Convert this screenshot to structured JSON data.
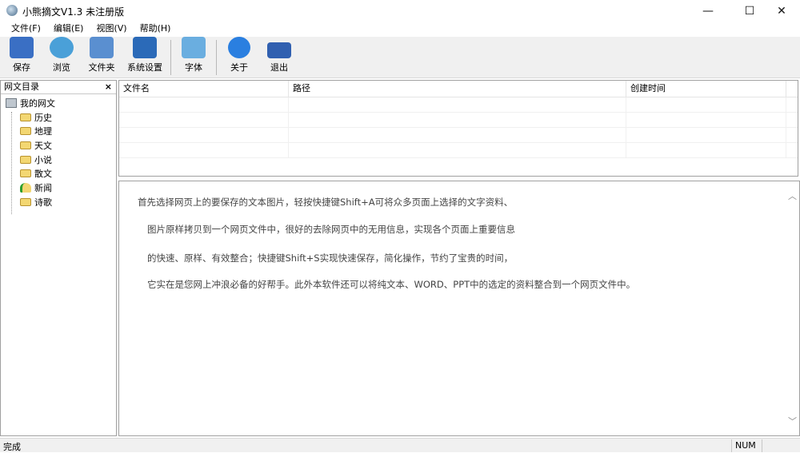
{
  "window": {
    "title": "小熊摘文V1.3 未注册版",
    "minimize": "—",
    "maximize": "☐",
    "close": "✕"
  },
  "menu": [
    "文件(F)",
    "编辑(E)",
    "视图(V)",
    "帮助(H)"
  ],
  "toolbar": [
    {
      "label": "保存",
      "icon": "save-icon",
      "color": "#3a6fc4"
    },
    {
      "label": "浏览",
      "icon": "browse-icon",
      "color": "#4aa0d8"
    },
    {
      "label": "文件夹",
      "icon": "folder-icon",
      "color": "#5a8fd0"
    },
    {
      "label": "系统设置",
      "icon": "settings-icon",
      "color": "#2b6ab8"
    },
    {
      "label": "字体",
      "icon": "font-icon",
      "color": "#6aaee0"
    },
    {
      "label": "关于",
      "icon": "info-icon",
      "color": "#2a7fe0"
    },
    {
      "label": "退出",
      "icon": "exit-icon",
      "color": "#3060b0"
    }
  ],
  "sidebar": {
    "title": "网文目录",
    "close": "×",
    "root": "我的网文",
    "items": [
      "历史",
      "地理",
      "天文",
      "小说",
      "散文",
      "新闻",
      "诗歌"
    ]
  },
  "grid": {
    "columns": [
      "文件名",
      "路径",
      "创建时间"
    ]
  },
  "content": {
    "paragraphs": [
      "首先选择网页上的要保存的文本图片，轻按快捷键Shift+A可将众多页面上选择的文字资料、",
      "图片原样拷贝到一个网页文件中，很好的去除网页中的无用信息，实现各个页面上重要信息",
      "的快速、原样、有效整合；快捷键Shift+S实现快速保存，简化操作，节约了宝贵的时间，",
      "它实在是您网上冲浪必备的好帮手。此外本软件还可以将纯文本、WORD、PPT中的选定的资料整合到一个网页文件中。"
    ],
    "scroll_up": "︿",
    "scroll_down": "﹀"
  },
  "status": {
    "text": "完成",
    "num": "NUM"
  }
}
